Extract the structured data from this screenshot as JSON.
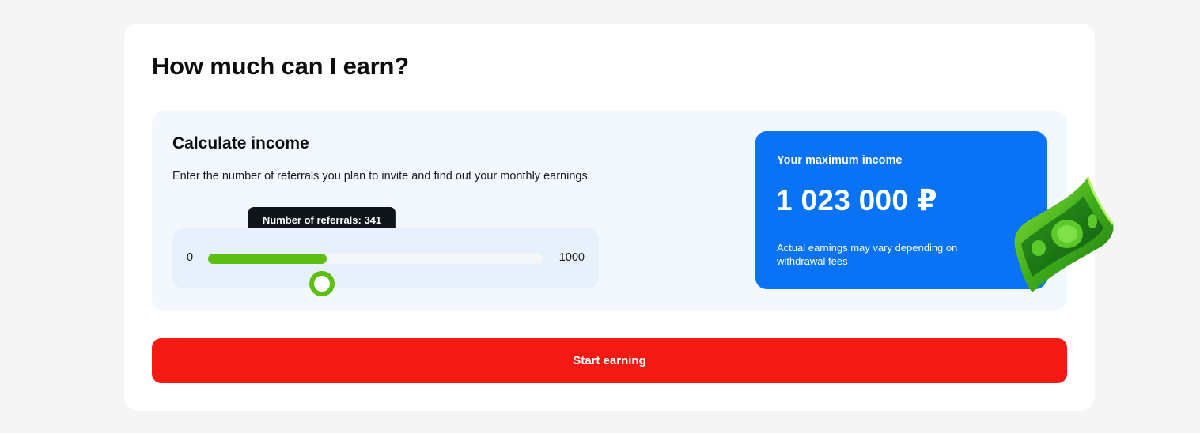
{
  "section": {
    "title": "How much can I earn?"
  },
  "calculator": {
    "title": "Calculate income",
    "description": "Enter the number of referrals you plan to invite and find out your monthly earnings",
    "slider": {
      "min_label": "0",
      "max_label": "1000",
      "min": 0,
      "max": 1000,
      "value": 341,
      "tooltip": "Number of referrals: 341",
      "fill_color": "#5cbf12"
    }
  },
  "income": {
    "label": "Your maximum income",
    "value": "1 023 000 ₽",
    "note": "Actual earnings may vary depending on withdrawal fees",
    "card_color": "#0a73f5",
    "decoration_icon": "money-banknote-icon"
  },
  "cta": {
    "label": "Start earning",
    "color": "#f41a14"
  }
}
